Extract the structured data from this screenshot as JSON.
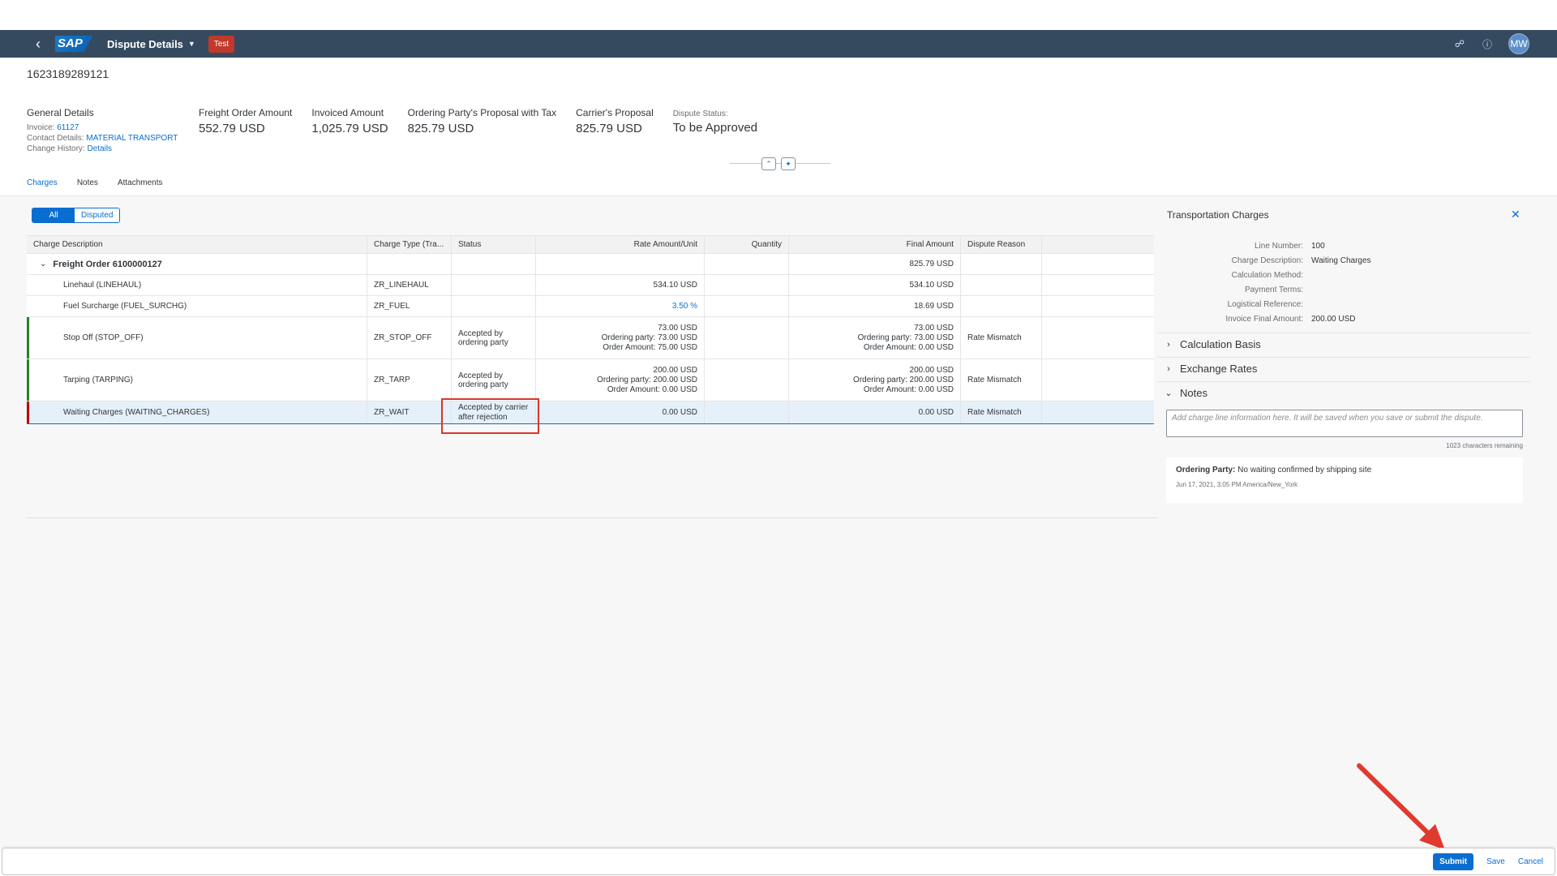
{
  "shell": {
    "app_title": "Dispute Details",
    "system_badge": "Test",
    "avatar_initials": "MW",
    "logo_text": "SAP"
  },
  "header": {
    "object_id": "1623189289121",
    "general": {
      "title": "General Details",
      "invoice_label": "Invoice:",
      "invoice_value": "61127",
      "contact_label": "Contact Details:",
      "contact_value": "MATERIAL TRANSPORT",
      "history_label": "Change History:",
      "history_value": "Details"
    },
    "kpis": [
      {
        "label": "Freight Order Amount",
        "value": "552.79 USD"
      },
      {
        "label": "Invoiced Amount",
        "value": "1,025.79 USD"
      },
      {
        "label": "Ordering Party's Proposal with Tax",
        "value": "825.79 USD"
      },
      {
        "label": "Carrier's Proposal",
        "value": "825.79 USD"
      }
    ],
    "status": {
      "label": "Dispute Status:",
      "value": "To be Approved"
    }
  },
  "tabs": [
    "Charges",
    "Notes",
    "Attachments"
  ],
  "filter": {
    "all": "All",
    "disputed": "Disputed"
  },
  "table": {
    "columns": [
      "Charge Description",
      "Charge Type (Tra...",
      "Status",
      "Rate Amount/Unit",
      "Quantity",
      "Final Amount",
      "Dispute Reason",
      ""
    ],
    "group": {
      "label": "Freight Order 6100000127",
      "final": "825.79 USD"
    },
    "rows": [
      {
        "desc": "Linehaul (LINEHAUL)",
        "type": "ZR_LINEHAUL",
        "status": "",
        "rate": "534.10 USD",
        "rate2": "",
        "rate3": "",
        "final": "534.10 USD",
        "final2": "",
        "final3": "",
        "reason": ""
      },
      {
        "desc": "Fuel Surcharge (FUEL_SURCHG)",
        "type": "ZR_FUEL",
        "status": "",
        "rate": "3.50 %",
        "rate2": "",
        "rate3": "",
        "final": "18.69 USD",
        "final2": "",
        "final3": "",
        "reason": ""
      },
      {
        "desc": "Stop Off (STOP_OFF)",
        "type": "ZR_STOP_OFF",
        "status": "Accepted by ordering party",
        "rate": "73.00 USD",
        "rate2": "Ordering party: 73.00 USD",
        "rate3": "Order Amount: 75.00 USD",
        "final": "73.00 USD",
        "final2": "Ordering party: 73.00 USD",
        "final3": "Order Amount: 0.00 USD",
        "reason": "Rate Mismatch"
      },
      {
        "desc": "Tarping (TARPING)",
        "type": "ZR_TARP",
        "status": "Accepted by ordering party",
        "rate": "200.00 USD",
        "rate2": "Ordering party: 200.00 USD",
        "rate3": "Order Amount: 0.00 USD",
        "final": "200.00 USD",
        "final2": "Ordering party: 200.00 USD",
        "final3": "Order Amount: 0.00 USD",
        "reason": "Rate Mismatch"
      },
      {
        "desc": "Waiting Charges (WAITING_CHARGES)",
        "type": "ZR_WAIT",
        "status": "Accepted by carrier after rejection",
        "rate": "0.00 USD",
        "rate2": "",
        "rate3": "",
        "final": "0.00 USD",
        "final2": "",
        "final3": "",
        "reason": "Rate Mismatch"
      }
    ]
  },
  "side_panel": {
    "title": "Transportation Charges",
    "fields": [
      {
        "label": "Line Number:",
        "value": "100"
      },
      {
        "label": "Charge Description:",
        "value": "Waiting Charges"
      },
      {
        "label": "Calculation Method:",
        "value": ""
      },
      {
        "label": "Payment Terms:",
        "value": ""
      },
      {
        "label": "Logistical Reference:",
        "value": ""
      },
      {
        "label": "Invoice Final Amount:",
        "value": "200.00 USD"
      }
    ],
    "sections": [
      "Calculation Basis",
      "Exchange Rates",
      "Notes"
    ],
    "notes_placeholder": "Add charge line information here. It will be saved when you save or submit the dispute.",
    "chars_remaining": "1023 characters remaining",
    "note": {
      "author": "Ordering Party:",
      "text": "No waiting confirmed by shipping site",
      "timestamp": "Jun 17, 2021, 3:05 PM America/New_York"
    }
  },
  "footer": {
    "submit": "Submit",
    "save": "Save",
    "cancel": "Cancel"
  },
  "colors": {
    "shell": "#354a5f",
    "accent": "#0a6ed1",
    "highlight_green": "#2b7d2b",
    "highlight_red": "#bb0000",
    "annotation": "#d9362b"
  }
}
